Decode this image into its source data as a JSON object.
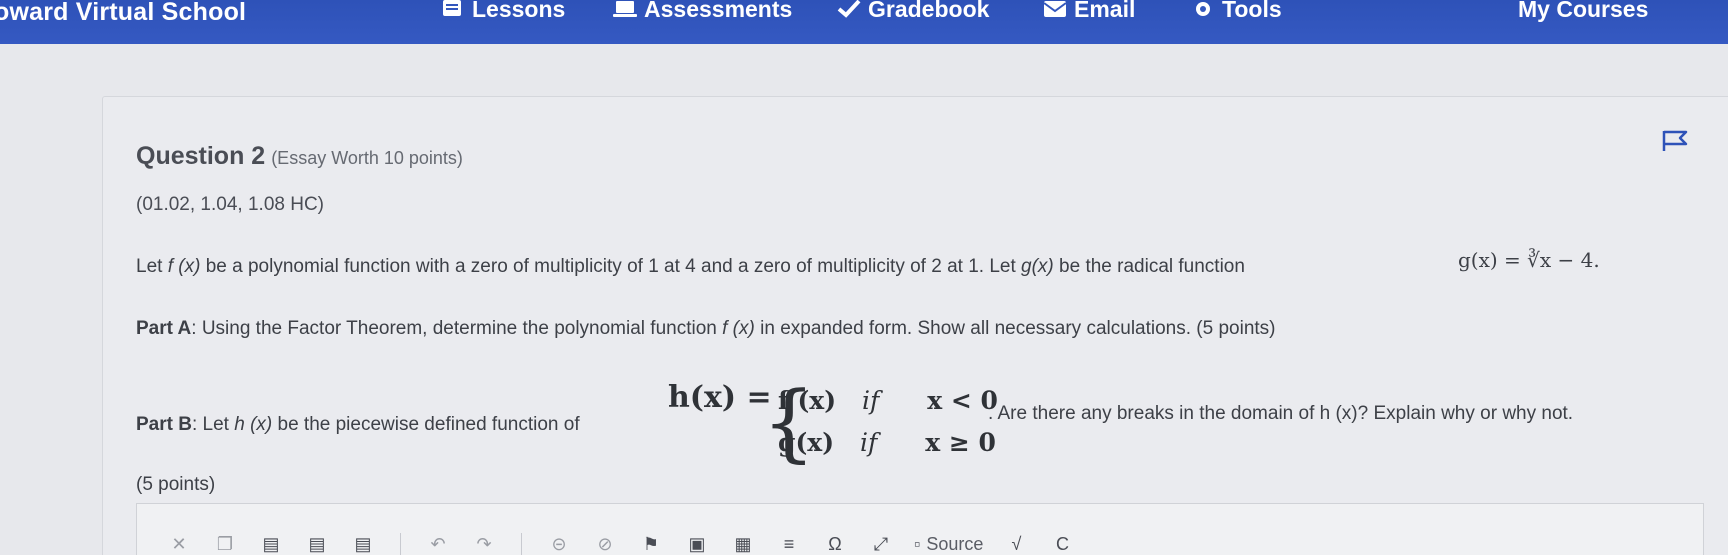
{
  "nav": {
    "brand": "oward Virtual School",
    "items": [
      {
        "label": "Lessons",
        "icon": "book-icon"
      },
      {
        "label": "Assessments",
        "icon": "laptop-icon"
      },
      {
        "label": "Gradebook",
        "icon": "checkmark-icon"
      },
      {
        "label": "Email",
        "icon": "envelope-icon"
      },
      {
        "label": "Tools",
        "icon": "gear-icon"
      },
      {
        "label": "My Courses",
        "icon": ""
      }
    ]
  },
  "question": {
    "title": "Question 2",
    "type": "(Essay Worth 10 points)",
    "standards": "(01.02, 1.04, 1.08 HC)",
    "intro_part1": "Let ",
    "intro_fx": "f (x)",
    "intro_part2": " be a polynomial function with a zero of multiplicity of 1 at 4 and a zero of multiplicity of 2 at 1. Let ",
    "intro_gx": "g(x)",
    "intro_part3": " be the radical function",
    "g_formula": "g(x) = ∛x − 4.",
    "partA_label": "Part A",
    "partA_text": ": Using the Factor Theorem, determine the polynomial function ",
    "partA_fx": "f (x)",
    "partA_text2": " in expanded form. Show all necessary calculations. (5 points)",
    "partB_label": "Part B",
    "partB_text": ": Let ",
    "partB_hx": "h (x)",
    "partB_text2": " be the piecewise defined function of",
    "h_lhs": "h(x) =",
    "piece1_func": "f (x)",
    "piece1_if": "if",
    "piece1_cond": "x < 0",
    "piece2_func": "g(x)",
    "piece2_if": "if",
    "piece2_cond": "x ≥ 0",
    "partB_after": ". Are there any breaks in the domain of h (x)? Explain why or why not.",
    "partB_points": "(5 points)"
  },
  "editor": {
    "source_label": "Source"
  },
  "colors": {
    "nav_bg": "#3357bd",
    "accent": "#2e52b8"
  }
}
